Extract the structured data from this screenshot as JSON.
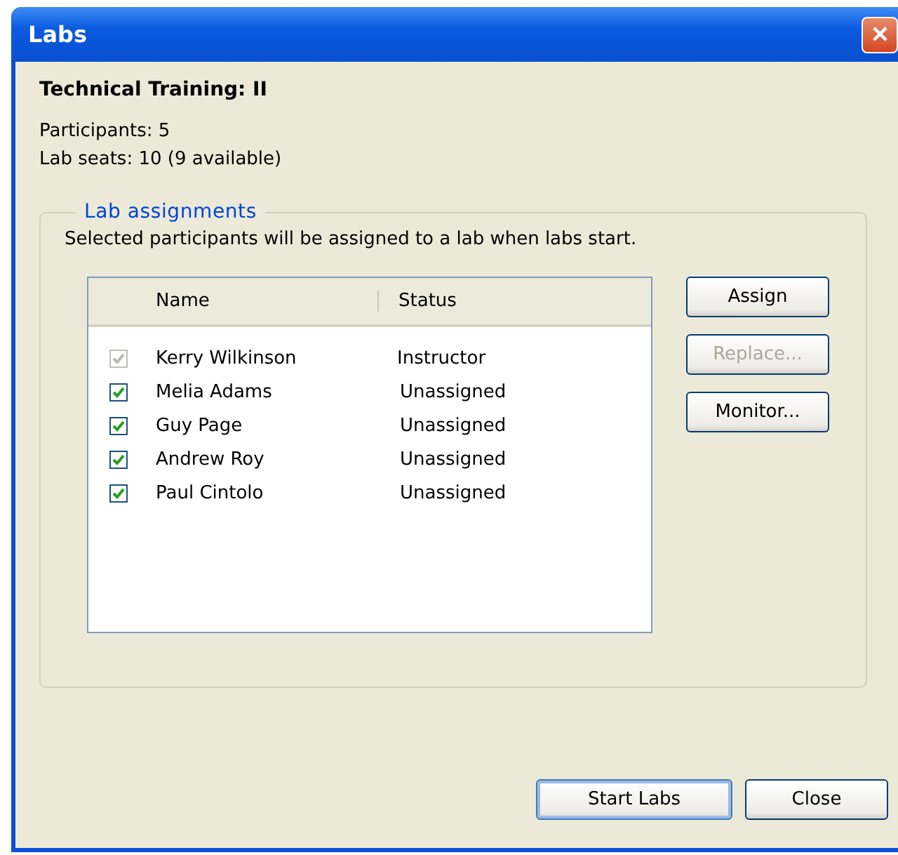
{
  "window": {
    "title": "Labs",
    "close": "✕"
  },
  "heading": "Technical Training: II",
  "info": [
    "Participants: 5",
    "Lab seats: 10 (9 available)"
  ],
  "group": {
    "legend": "Lab assignments",
    "description": "Selected participants will be assigned to a lab when labs start."
  },
  "table": {
    "columns": [
      "Name",
      "Status"
    ],
    "rows": [
      {
        "name": "Kerry Wilkinson",
        "status": "Instructor",
        "checked": true,
        "disabled": true
      },
      {
        "name": "Melia Adams",
        "status": "Unassigned",
        "checked": true,
        "disabled": false
      },
      {
        "name": "Guy Page",
        "status": "Unassigned",
        "checked": true,
        "disabled": false
      },
      {
        "name": "Andrew Roy",
        "status": "Unassigned",
        "checked": true,
        "disabled": false
      },
      {
        "name": "Paul Cintolo",
        "status": "Unassigned",
        "checked": true,
        "disabled": false
      }
    ]
  },
  "side_buttons": [
    {
      "label": "Assign",
      "disabled": false
    },
    {
      "label": "Replace...",
      "disabled": true
    },
    {
      "label": "Monitor...",
      "disabled": false
    }
  ],
  "footer_buttons": [
    {
      "label": "Start Labs",
      "default": true
    },
    {
      "label": "Close",
      "default": false
    }
  ]
}
